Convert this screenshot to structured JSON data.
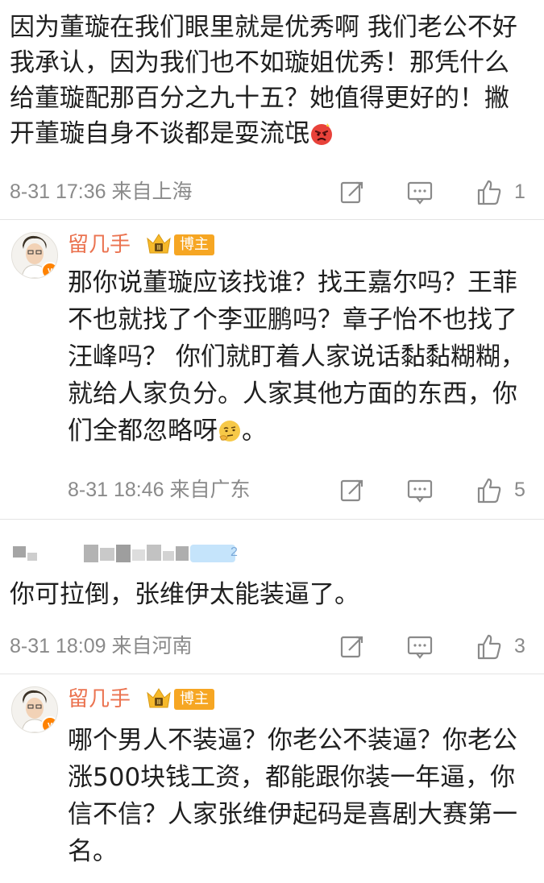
{
  "comments": [
    {
      "text": "因为董璇在我们眼里就是优秀啊 我们老公不好我承认，因为我们也不如璇姐优秀！那凭什么给董璇配那百分之九十五？她值得更好的！撇开董璇自身不谈都是耍流氓",
      "emoji": "angry-face",
      "time": "8-31 17:36",
      "location": "来自上海",
      "likes": "1"
    },
    {
      "user": "留几手",
      "tag": "博主",
      "text": "那你说董璇应该找谁？找王嘉尔吗？王菲不也就找了个李亚鹏吗？章子怡不也找了汪峰吗？ 你们就盯着人家说话黏黏糊糊，就给人家负分。人家其他方面的东西，你们全都忽略呀",
      "text_end": "。",
      "emoji": "thinking-face",
      "time": "8-31 18:46",
      "location": "来自广东",
      "likes": "5"
    },
    {
      "user_level": "2",
      "text": "你可拉倒，张维伊太能装逼了。",
      "time": "8-31 18:09",
      "location": "来自河南",
      "likes": "3"
    },
    {
      "user": "留几手",
      "tag": "博主",
      "text": "哪个男人不装逼？你老公不装逼？你老公涨500块钱工资，都能跟你装一年逼，你信不信？人家张维伊起码是喜剧大赛第一名。"
    }
  ],
  "colors": {
    "username": "#eb7350",
    "tag": "#f6a623",
    "meta": "#8a8a8a"
  }
}
